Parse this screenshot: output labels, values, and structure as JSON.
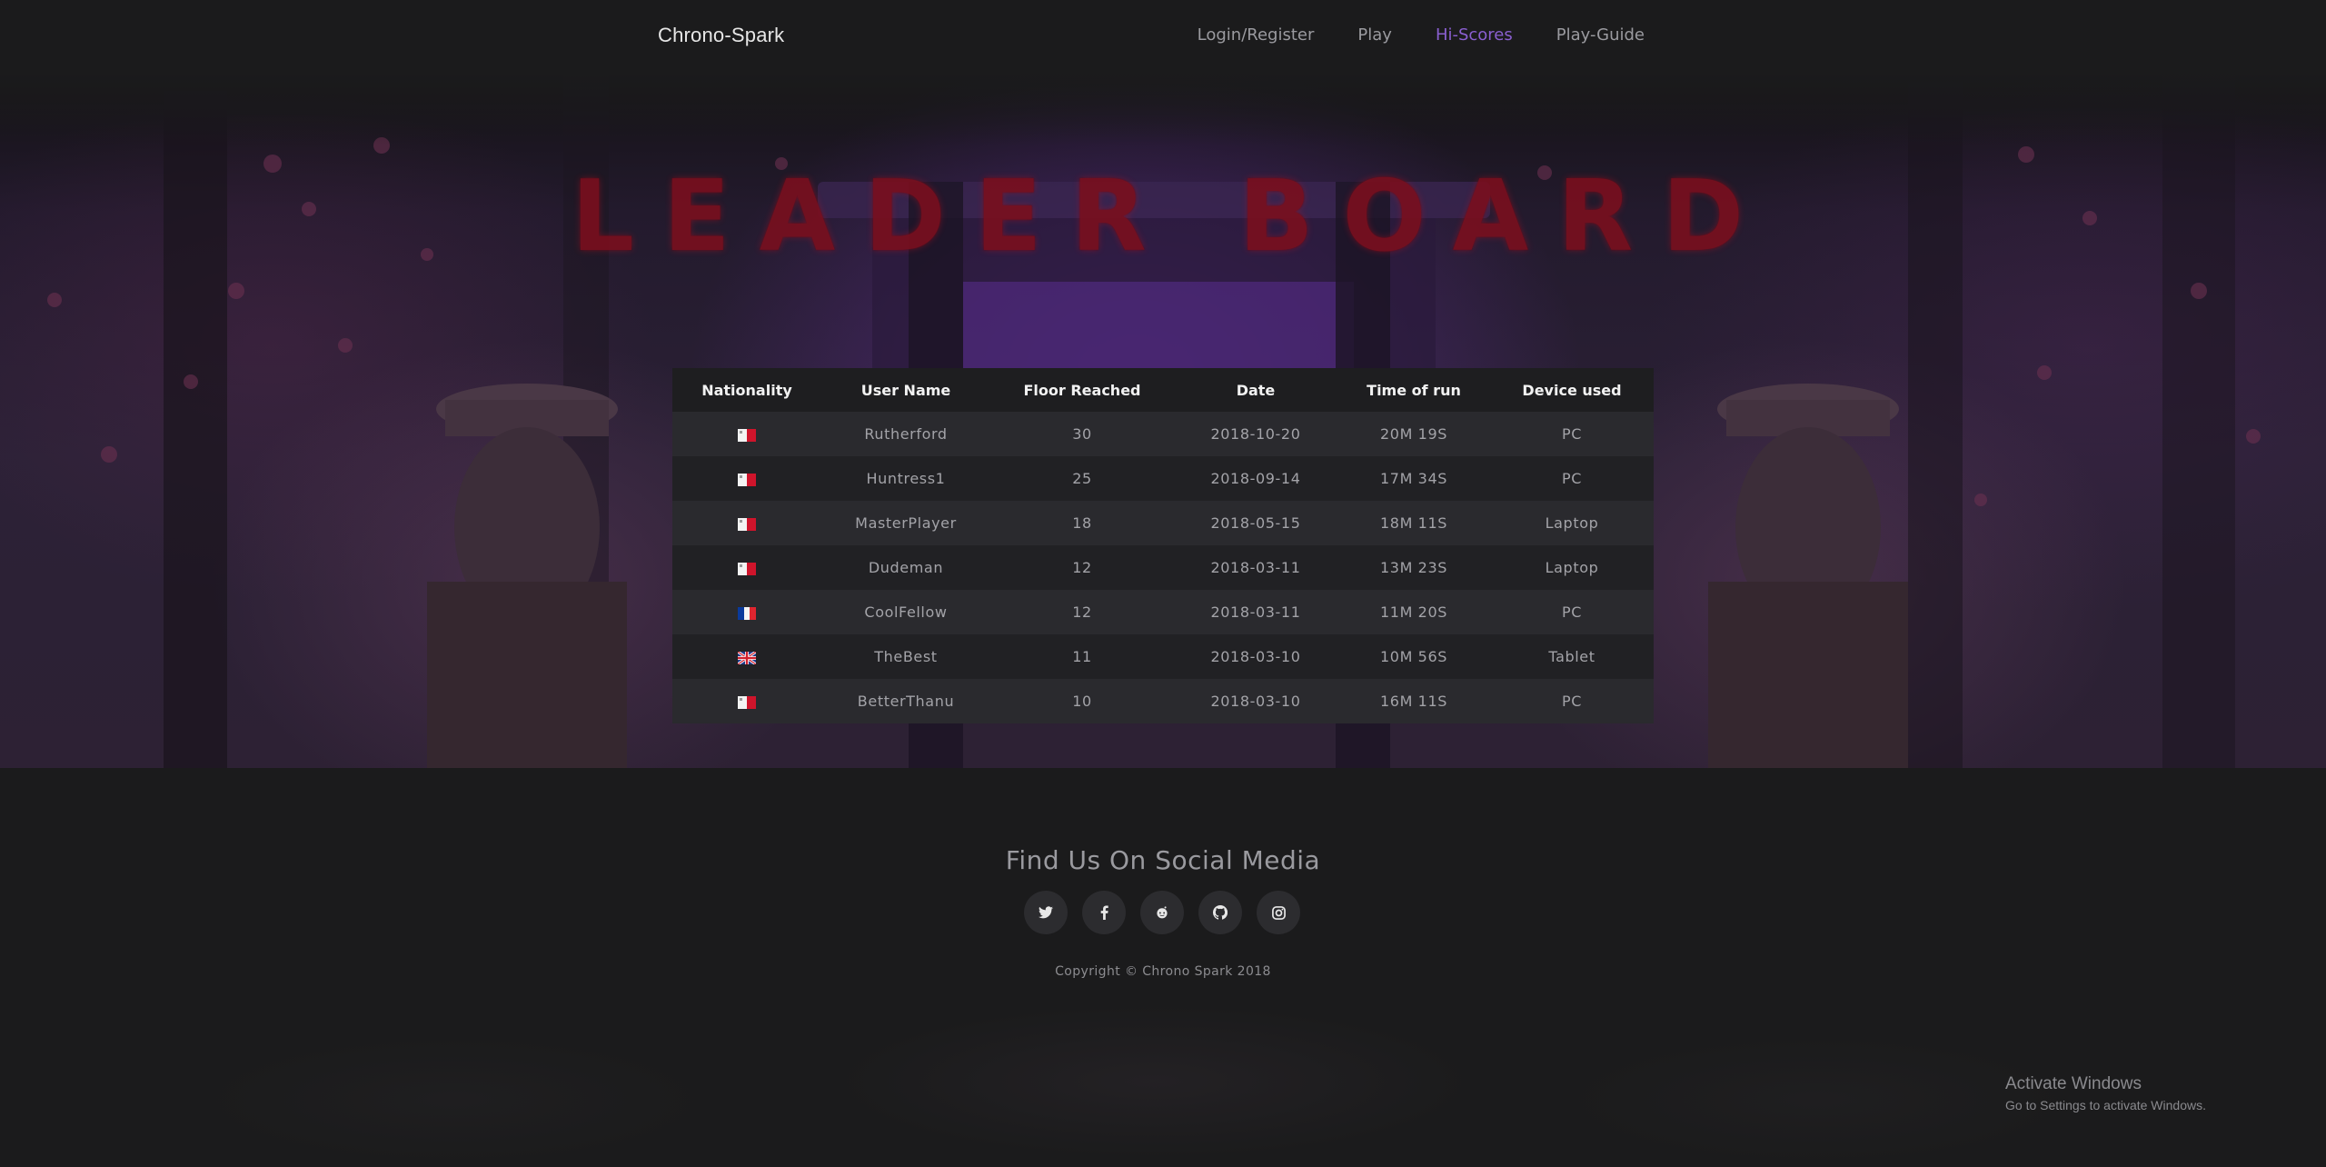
{
  "navbar": {
    "brand": "Chrono-Spark",
    "links": [
      {
        "label": "Login/Register",
        "active": false
      },
      {
        "label": "Play",
        "active": false
      },
      {
        "label": "Hi-Scores",
        "active": true
      },
      {
        "label": "Play-Guide",
        "active": false
      }
    ]
  },
  "hero": {
    "title": "LEADER BOARD"
  },
  "leaderboard": {
    "headers": [
      "Nationality",
      "User Name",
      "Floor Reached",
      "Date",
      "Time of run",
      "Device used"
    ],
    "rows": [
      {
        "nationality": "malta-flag-icon",
        "user": "Rutherford",
        "floor": "30",
        "date": "2018-10-20",
        "time": "20M 19S",
        "device": "PC"
      },
      {
        "nationality": "malta-flag-icon",
        "user": "Huntress1",
        "floor": "25",
        "date": "2018-09-14",
        "time": "17M 34S",
        "device": "PC"
      },
      {
        "nationality": "malta-flag-icon",
        "user": "MasterPlayer",
        "floor": "18",
        "date": "2018-05-15",
        "time": "18M 11S",
        "device": "Laptop"
      },
      {
        "nationality": "malta-flag-icon",
        "user": "Dudeman",
        "floor": "12",
        "date": "2018-03-11",
        "time": "13M 23S",
        "device": "Laptop"
      },
      {
        "nationality": "france-flag-icon",
        "user": "CoolFellow",
        "floor": "12",
        "date": "2018-03-11",
        "time": "11M 20S",
        "device": "PC"
      },
      {
        "nationality": "uk-flag-icon",
        "user": "TheBest",
        "floor": "11",
        "date": "2018-03-10",
        "time": "10M 56S",
        "device": "Tablet"
      },
      {
        "nationality": "malta-flag-icon",
        "user": "BetterThanu",
        "floor": "10",
        "date": "2018-03-10",
        "time": "16M 11S",
        "device": "PC"
      }
    ]
  },
  "footer": {
    "title": "Find Us On Social Media",
    "socials": [
      "twitter-icon",
      "facebook-icon",
      "reddit-icon",
      "github-icon",
      "instagram-icon"
    ],
    "copyright": "Copyright © Chrono Spark 2018"
  },
  "watermark": {
    "line1": "Activate Windows",
    "line2": "Go to Settings to activate Windows."
  },
  "colors": {
    "background": "#1b1b1c",
    "accent": "#8a5fd0",
    "title_red": "#7a0f1e"
  }
}
